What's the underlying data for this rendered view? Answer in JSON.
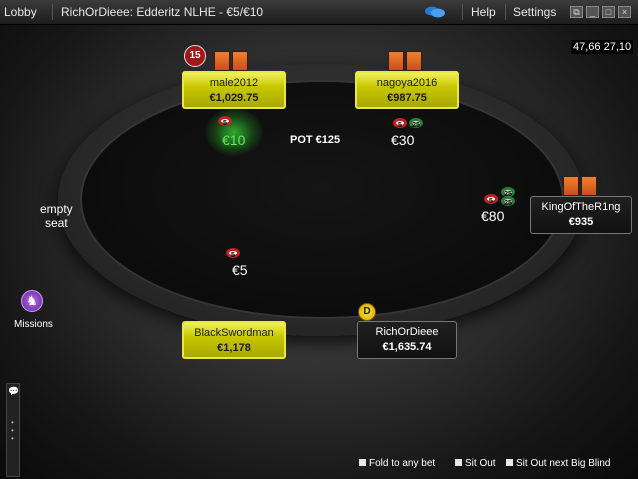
{
  "topbar": {
    "lobby": "Lobby",
    "title": "RichOrDieee: Edderitz NLHE - €5/€10",
    "help": "Help",
    "settings": "Settings"
  },
  "timer": "47,66  27,10",
  "players": {
    "male2012": {
      "name": "male2012",
      "stack": "€1,029.75",
      "bet": "€10",
      "level": "15"
    },
    "nagoya2016": {
      "name": "nagoya2016",
      "stack": "€987.75",
      "bet": "€30"
    },
    "king": {
      "name": "KingOfTheR1ng",
      "stack": "€935",
      "bet": "€80"
    },
    "black": {
      "name": "BlackSwordman",
      "stack": "€1,178",
      "bet": "€5"
    },
    "rich": {
      "name": "RichOrDieee",
      "stack": "€1,635.74"
    }
  },
  "chips": {
    "five": "5",
    "twentyfive": "25"
  },
  "pot": "POT €125",
  "empty_seat": {
    "line1": "empty",
    "line2": "seat"
  },
  "dealer": "D",
  "missions": "Missions",
  "options": {
    "fold_any": "Fold to any bet",
    "sit_out": "Sit Out",
    "sit_out_bb": "Sit Out next Big Blind"
  }
}
